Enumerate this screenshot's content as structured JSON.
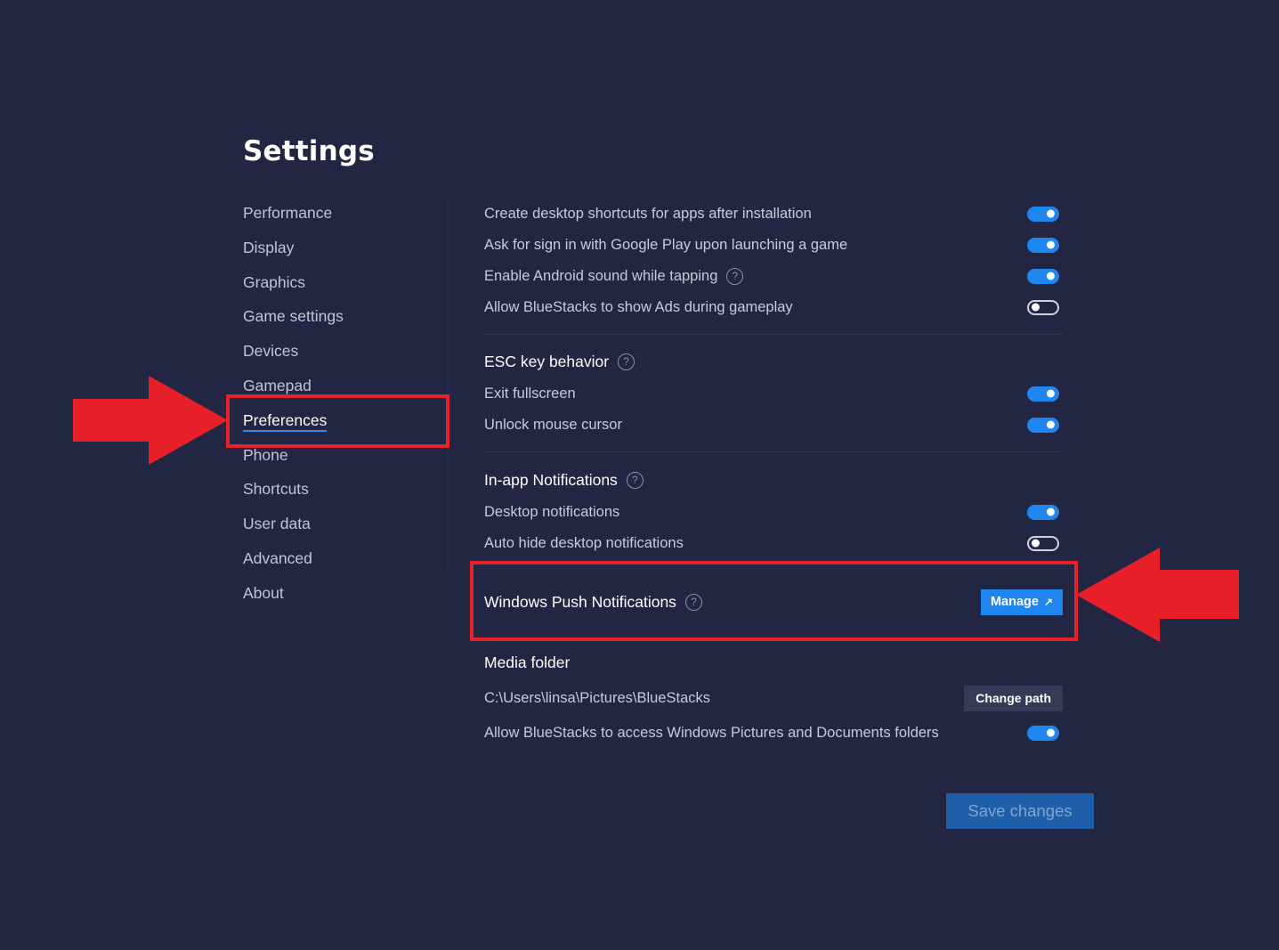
{
  "title": "Settings",
  "sidebar": {
    "items": [
      {
        "label": "Performance"
      },
      {
        "label": "Display"
      },
      {
        "label": "Graphics"
      },
      {
        "label": "Game settings"
      },
      {
        "label": "Devices"
      },
      {
        "label": "Gamepad"
      },
      {
        "label": "Preferences",
        "active": true
      },
      {
        "label": "Phone"
      },
      {
        "label": "Shortcuts"
      },
      {
        "label": "User data"
      },
      {
        "label": "Advanced"
      },
      {
        "label": "About"
      }
    ]
  },
  "general": {
    "desktop_shortcuts": {
      "label": "Create desktop shortcuts for apps after installation",
      "state": "on"
    },
    "google_sign_in": {
      "label": "Ask for sign in with Google Play upon launching a game",
      "state": "on"
    },
    "android_sound": {
      "label": "Enable Android sound while tapping",
      "state": "on"
    },
    "show_ads": {
      "label": "Allow BlueStacks to show Ads during gameplay",
      "state": "off"
    }
  },
  "esc_section": {
    "title": "ESC key behavior",
    "exit_fullscreen": {
      "label": "Exit fullscreen",
      "state": "on"
    },
    "unlock_cursor": {
      "label": "Unlock mouse cursor",
      "state": "on"
    }
  },
  "notifications_section": {
    "title": "In-app Notifications",
    "desktop_notifications": {
      "label": "Desktop notifications",
      "state": "on"
    },
    "auto_hide": {
      "label": "Auto hide desktop notifications",
      "state": "off"
    }
  },
  "push_section": {
    "title": "Windows Push Notifications",
    "manage_label": "Manage",
    "manage_icon": "↗"
  },
  "media_section": {
    "title": "Media folder",
    "path": "C:\\Users\\linsa\\Pictures\\BlueStacks",
    "change_path_label": "Change path",
    "allow_access": {
      "label": "Allow BlueStacks to access Windows Pictures and Documents folders",
      "state": "on"
    }
  },
  "help_icon": "?",
  "save_label": "Save changes",
  "colors": {
    "background": "#222643",
    "accent": "#1f86f0",
    "highlight": "#e8202a"
  }
}
